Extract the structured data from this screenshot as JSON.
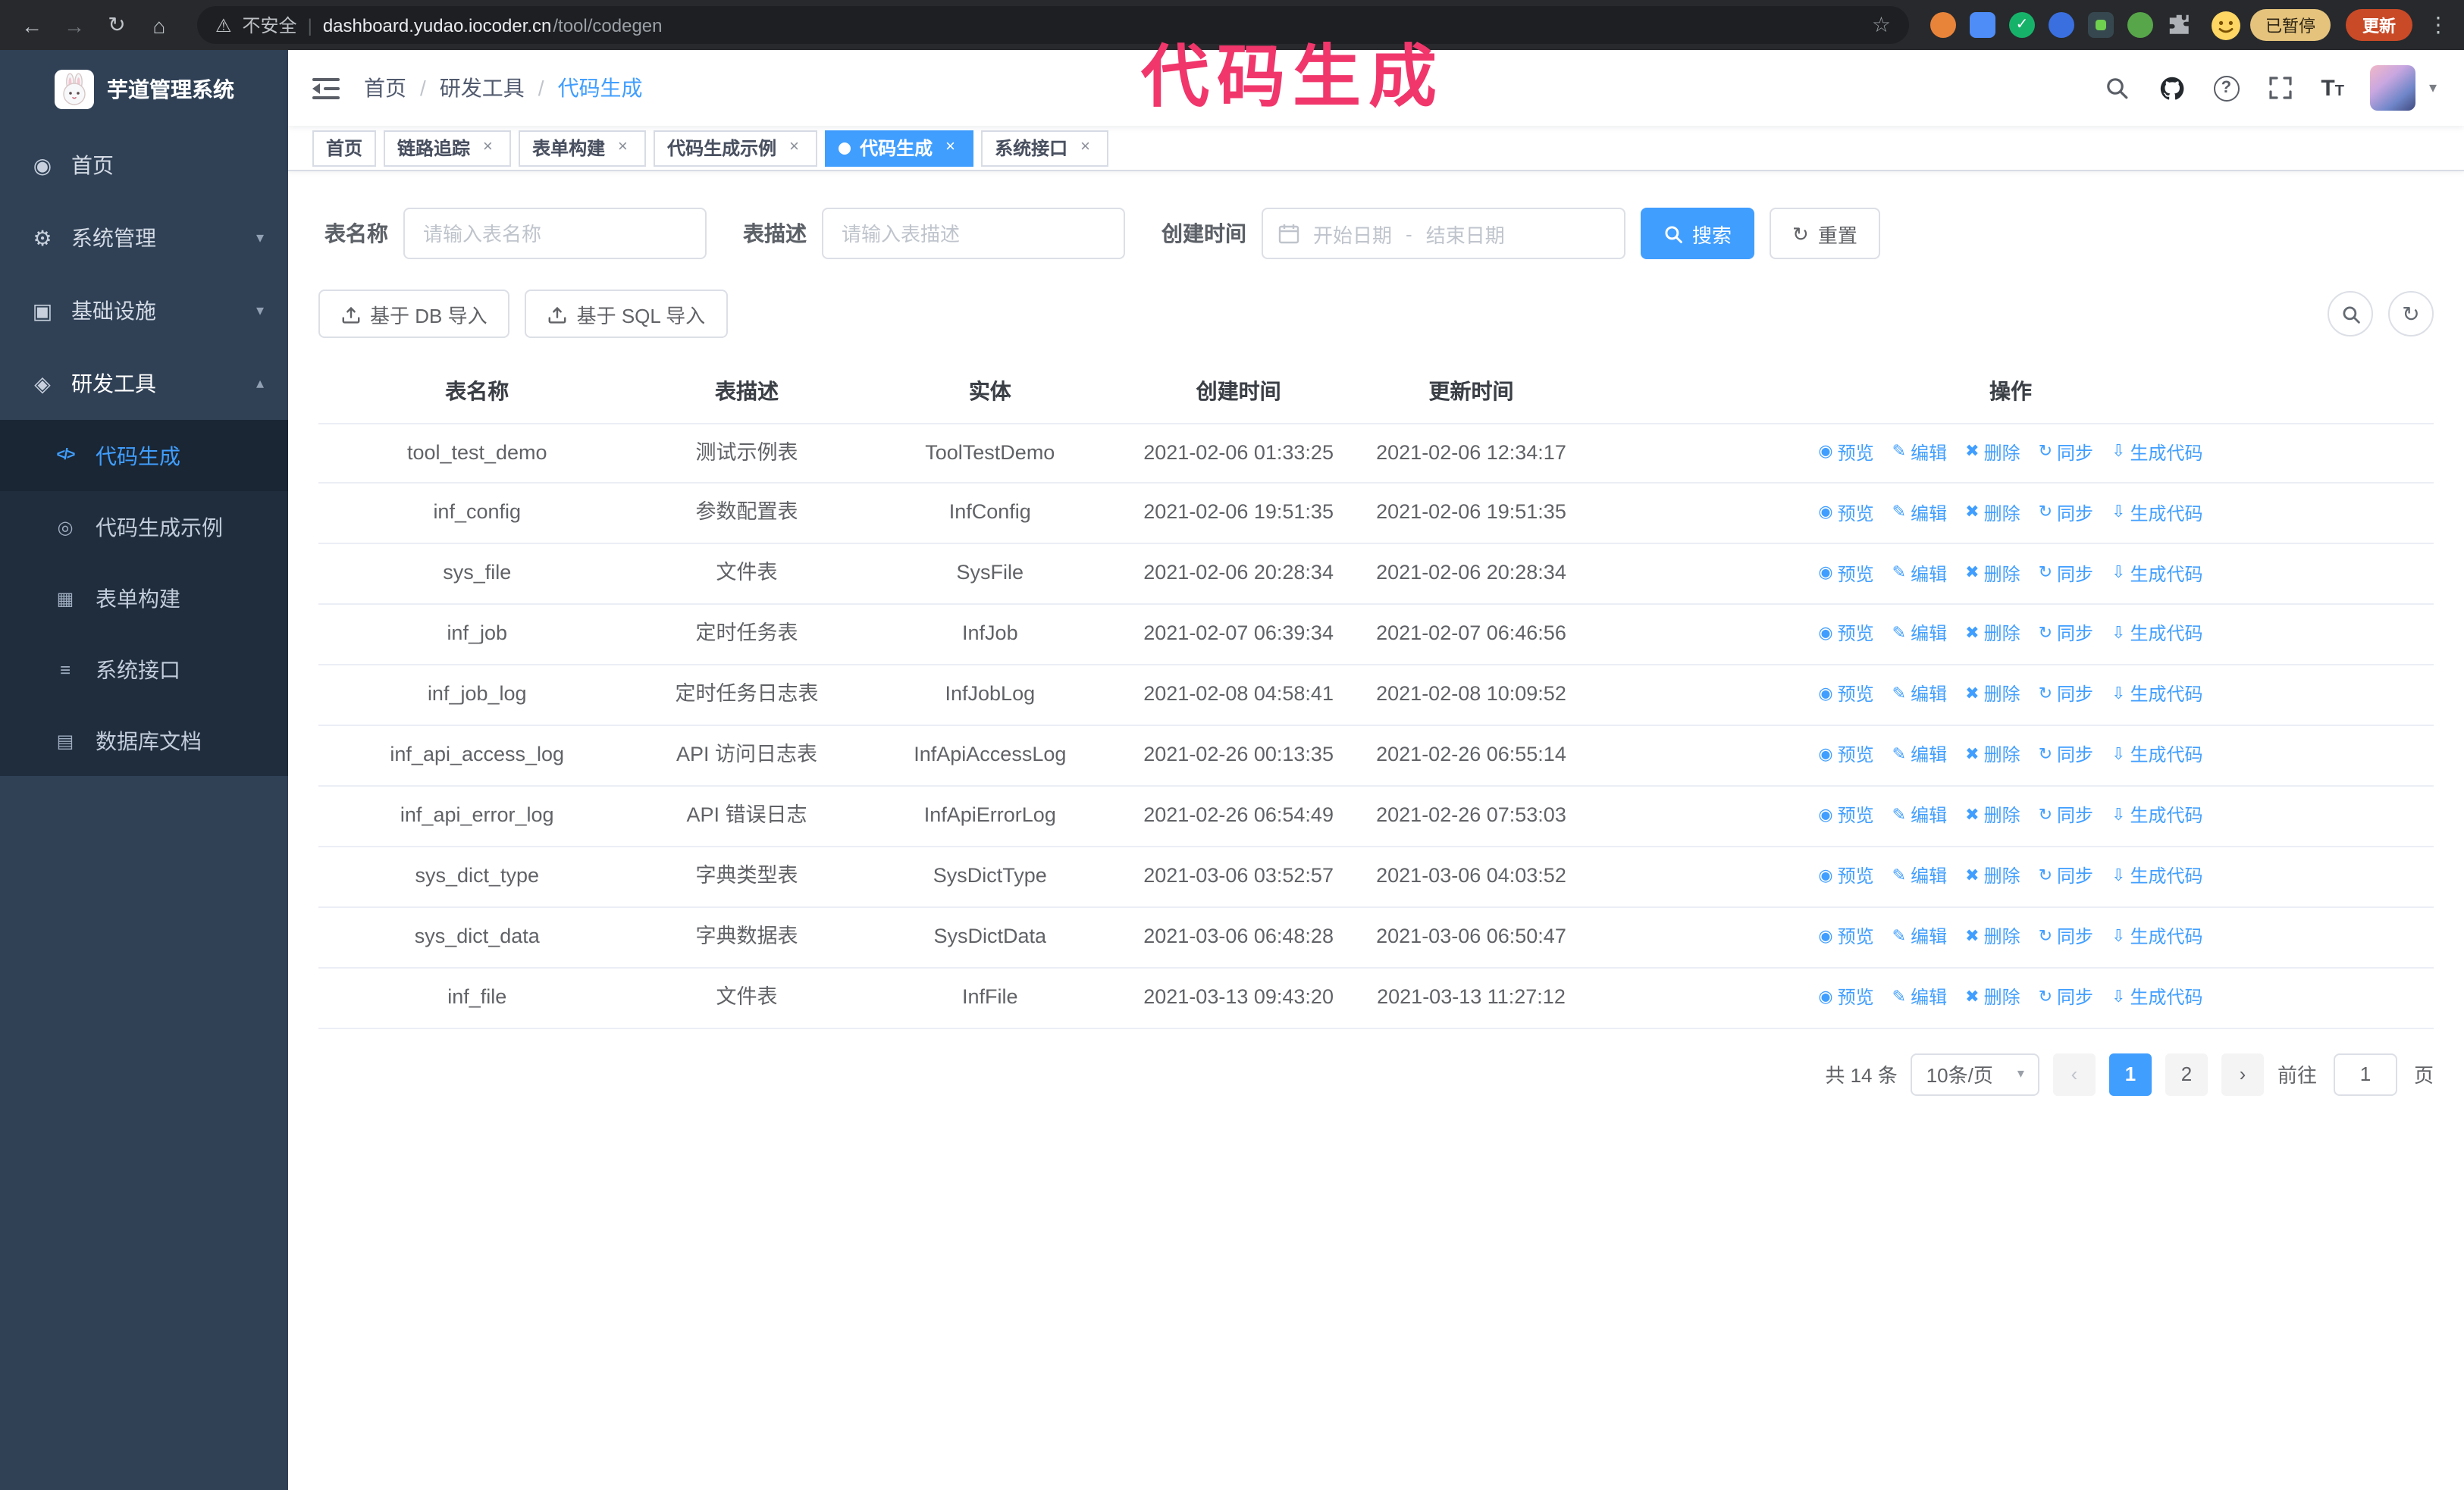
{
  "browser": {
    "security_label": "不安全",
    "url_host": "dashboard.yudao.iocoder.cn",
    "url_path": "/tool/codegen",
    "profile_badge": "已暂停",
    "update_label": "更新"
  },
  "annotation": {
    "text": "代码生成",
    "color": "#f0366b"
  },
  "colors": {
    "accent": "#409EFF",
    "sidebar_bg": "#304156",
    "submenu_bg": "#1f2d3d",
    "table_border": "#ebeef5"
  },
  "app_title": "芋道管理系统",
  "sidebar": {
    "items": [
      {
        "label": "首页",
        "icon": "dashboard-icon"
      },
      {
        "label": "系统管理",
        "icon": "gear-icon"
      },
      {
        "label": "基础设施",
        "icon": "monitor-icon"
      },
      {
        "label": "研发工具",
        "icon": "education-icon"
      }
    ],
    "dev_submenu": [
      {
        "label": "代码生成",
        "icon": "code-icon",
        "active": true
      },
      {
        "label": "代码生成示例",
        "icon": "badge-icon",
        "active": false
      },
      {
        "label": "表单构建",
        "icon": "form-icon",
        "active": false
      },
      {
        "label": "系统接口",
        "icon": "api-icon",
        "active": false
      },
      {
        "label": "数据库文档",
        "icon": "database-icon",
        "active": false
      }
    ]
  },
  "breadcrumb": {
    "separator": "/",
    "items": [
      {
        "label": "首页"
      },
      {
        "label": "研发工具"
      },
      {
        "label": "代码生成"
      }
    ]
  },
  "tabs": [
    {
      "label": "首页",
      "closable": false,
      "active": false
    },
    {
      "label": "链路追踪",
      "closable": true,
      "active": false
    },
    {
      "label": "表单构建",
      "closable": true,
      "active": false
    },
    {
      "label": "代码生成示例",
      "closable": true,
      "active": false
    },
    {
      "label": "代码生成",
      "closable": true,
      "active": true
    },
    {
      "label": "系统接口",
      "closable": true,
      "active": false
    }
  ],
  "filters": {
    "table_name_label": "表名称",
    "table_name_placeholder": "请输入表名称",
    "table_desc_label": "表描述",
    "table_desc_placeholder": "请输入表描述",
    "create_time_label": "创建时间",
    "start_placeholder": "开始日期",
    "range_separator": "-",
    "end_placeholder": "结束日期",
    "search_label": "搜索",
    "reset_label": "重置"
  },
  "toolbar": {
    "import_db_label": "基于 DB 导入",
    "import_sql_label": "基于 SQL 导入"
  },
  "icons": {
    "eye-icon": "◉",
    "edit-icon": "✎",
    "delete-icon": "✖",
    "sync-icon": "↻",
    "download-icon": "⇩"
  },
  "table": {
    "columns": [
      "表名称",
      "表描述",
      "实体",
      "创建时间",
      "更新时间",
      "操作"
    ],
    "actions": [
      {
        "label": "预览",
        "icon": "eye-icon"
      },
      {
        "label": "编辑",
        "icon": "edit-icon"
      },
      {
        "label": "删除",
        "icon": "delete-icon"
      },
      {
        "label": "同步",
        "icon": "sync-icon"
      },
      {
        "label": "生成代码",
        "icon": "download-icon"
      }
    ],
    "rows": [
      {
        "name": "tool_test_demo",
        "desc": "测试示例表",
        "entity": "ToolTestDemo",
        "created": "2021-02-06 01:33:25",
        "updated": "2021-02-06 12:34:17"
      },
      {
        "name": "inf_config",
        "desc": "参数配置表",
        "entity": "InfConfig",
        "created": "2021-02-06 19:51:35",
        "updated": "2021-02-06 19:51:35"
      },
      {
        "name": "sys_file",
        "desc": "文件表",
        "entity": "SysFile",
        "created": "2021-02-06 20:28:34",
        "updated": "2021-02-06 20:28:34"
      },
      {
        "name": "inf_job",
        "desc": "定时任务表",
        "entity": "InfJob",
        "created": "2021-02-07 06:39:34",
        "updated": "2021-02-07 06:46:56"
      },
      {
        "name": "inf_job_log",
        "desc": "定时任务日志表",
        "entity": "InfJobLog",
        "created": "2021-02-08 04:58:41",
        "updated": "2021-02-08 10:09:52"
      },
      {
        "name": "inf_api_access_log",
        "desc": "API 访问日志表",
        "entity": "InfApiAccessLog",
        "created": "2021-02-26 00:13:35",
        "updated": "2021-02-26 06:55:14"
      },
      {
        "name": "inf_api_error_log",
        "desc": "API 错误日志",
        "entity": "InfApiErrorLog",
        "created": "2021-02-26 06:54:49",
        "updated": "2021-02-26 07:53:03"
      },
      {
        "name": "sys_dict_type",
        "desc": "字典类型表",
        "entity": "SysDictType",
        "created": "2021-03-06 03:52:57",
        "updated": "2021-03-06 04:03:52"
      },
      {
        "name": "sys_dict_data",
        "desc": "字典数据表",
        "entity": "SysDictData",
        "created": "2021-03-06 06:48:28",
        "updated": "2021-03-06 06:50:47"
      },
      {
        "name": "inf_file",
        "desc": "文件表",
        "entity": "InfFile",
        "created": "2021-03-13 09:43:20",
        "updated": "2021-03-13 11:27:12"
      }
    ]
  },
  "pagination": {
    "total_label": "共 14 条",
    "page_size_label": "10条/页",
    "pages": [
      "1",
      "2"
    ],
    "active_page": "1",
    "goto_prefix": "前往",
    "goto_value": "1",
    "goto_suffix": "页"
  }
}
